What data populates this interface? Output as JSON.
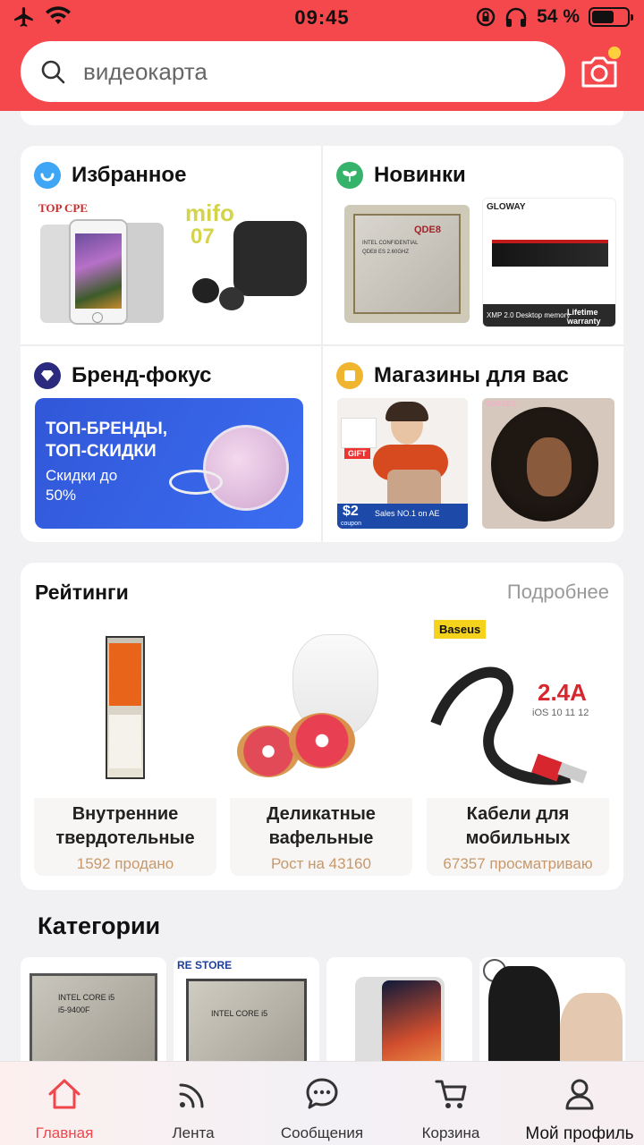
{
  "status_bar": {
    "time": "09:45",
    "battery_percent": "54 %"
  },
  "search": {
    "placeholder": "видеокарта"
  },
  "sections": [
    {
      "title": "Избранное",
      "icon": "smile-icon",
      "color": "#3ea6f5"
    },
    {
      "title": "Новинки",
      "icon": "sprout-icon",
      "color": "#36b36a"
    },
    {
      "title": "Бренд-фокус",
      "icon": "diamond-icon",
      "color": "#2b2a7f"
    },
    {
      "title": "Магазины для вас",
      "icon": "store-icon",
      "color": "#f0b52f"
    }
  ],
  "images": {
    "top_cpe": "TOP CPE",
    "mifo": "mifo",
    "mifo_model": "07",
    "qde": "QDE8",
    "intel_line1": "INTEL CONFIDENTIAL",
    "intel_line2": "QDE8 ES 2.60GHZ",
    "cloway": "GLOWAY",
    "xmp": "XMP 2.0 Desktop memory",
    "lifetime": "Lifetime warranty",
    "brand_banner_line1": "ТОП-БРЕНДЫ,",
    "brand_banner_line2": "ТОП-СКИДКИ",
    "brand_banner_line3": "Скидки до",
    "brand_banner_line4": "50%",
    "massager_gift": "GIFT",
    "coupon_amount": "$2",
    "coupon_label": "coupon",
    "sales_text": "Sales NO.1 on AE",
    "wig_brand": "DORSES",
    "baseus": "Baseus",
    "cable_amp": "2.4A",
    "cable_ios": "iOS 10 11 12",
    "re_store": "RE STORE",
    "cpu_label": "INTEL CORE i5",
    "cpu_model": "i5-9400F"
  },
  "ratings": {
    "title": "Рейтинги",
    "more": "Подробнее",
    "items": [
      {
        "name_line1": "Внутренние",
        "name_line2": "твердотельные",
        "sub": "1592 продано"
      },
      {
        "name_line1": "Деликатные",
        "name_line2": "вафельные",
        "sub": "Рост на 43160"
      },
      {
        "name_line1": "Кабели для",
        "name_line2": "мобильных",
        "sub": "67357 просматриваю"
      }
    ]
  },
  "categories": {
    "title": "Категории"
  },
  "nav": [
    {
      "label": "Главная",
      "icon": "home-icon"
    },
    {
      "label": "Лента",
      "icon": "feed-icon"
    },
    {
      "label": "Сообщения",
      "icon": "chat-icon"
    },
    {
      "label": "Корзина",
      "icon": "cart-icon"
    },
    {
      "label": "Мой профиль",
      "icon": "profile-icon"
    }
  ],
  "colors": {
    "header": "#f5484c",
    "accent": "#f0464b"
  }
}
